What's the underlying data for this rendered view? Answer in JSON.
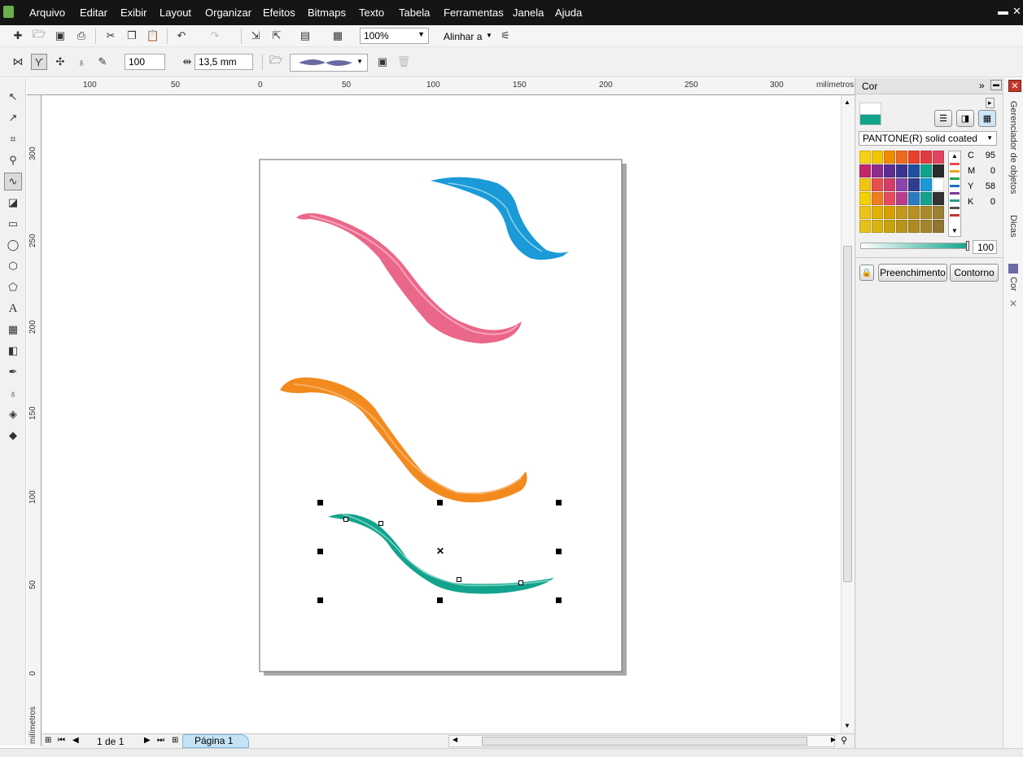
{
  "menu": [
    "Arquivo",
    "Editar",
    "Exibir",
    "Layout",
    "Organizar",
    "Efeitos",
    "Bitmaps",
    "Texto",
    "Tabela",
    "Ferramentas",
    "Janela",
    "Ajuda"
  ],
  "toolbar": {
    "zoom": "100%",
    "snap_label": "Alinhar a",
    "width_value": "100",
    "size_value": "13,5 mm"
  },
  "ruler": {
    "h_labels": [
      "100",
      "50",
      "0",
      "50",
      "100",
      "150",
      "200",
      "250",
      "300"
    ],
    "h_unit": "milímetros",
    "v_labels": [
      "300",
      "250",
      "200",
      "150",
      "100",
      "50",
      "0"
    ],
    "v_unit": "milímetros"
  },
  "page_nav": {
    "counter": "1 de 1",
    "tab": "Página 1"
  },
  "docker": {
    "title": "Cor",
    "palette": "PANTONE(R) solid coated",
    "cmyk": [
      {
        "k": "C",
        "v": "95"
      },
      {
        "k": "M",
        "v": "0"
      },
      {
        "k": "Y",
        "v": "58"
      },
      {
        "k": "K",
        "v": "0"
      }
    ],
    "tint": "100",
    "fill_button": "Preenchimento",
    "outline_button": "Contorno",
    "current_color": "#12a38a"
  },
  "side_tabs": [
    "Gerenciador de objetos",
    "Dicas",
    "Cor"
  ],
  "colors": {
    "pink": "#e8577d",
    "blue": "#1a9ad6",
    "orange": "#f28a1e",
    "teal": "#13a38c"
  },
  "swatches": [
    "#f7d117",
    "#f2c500",
    "#f08a00",
    "#ee6a1f",
    "#e8412b",
    "#e33a3f",
    "#e2435e",
    "#c3266d",
    "#8e2c8e",
    "#5b2e91",
    "#3a3592",
    "#1e4fa0",
    "#11a38a",
    "#2b2b2b",
    "#f1c40f",
    "#e84e4e",
    "#d23d6a",
    "#8e44ad",
    "#2f3d8f",
    "#1a9ad6",
    "#ffffff",
    "#f5d000",
    "#ee7d1d",
    "#e84a5f",
    "#b73e8d",
    "#2a7bc1",
    "#13a38c",
    "#333333",
    "#ecc31a",
    "#e1b100",
    "#d6a100",
    "#c4981a",
    "#b8901f",
    "#a88a2c",
    "#9c7f32",
    "#e6c21b",
    "#d9b314",
    "#c7a40e",
    "#b8951a",
    "#ad8b22",
    "#a4852b",
    "#917530"
  ],
  "strip_colors": [
    "#e84a4a",
    "#f0a020",
    "#2aa14f",
    "#1a6fc0",
    "#7a3a99",
    "#2e9e8e",
    "#555555",
    "#c0392b"
  ]
}
